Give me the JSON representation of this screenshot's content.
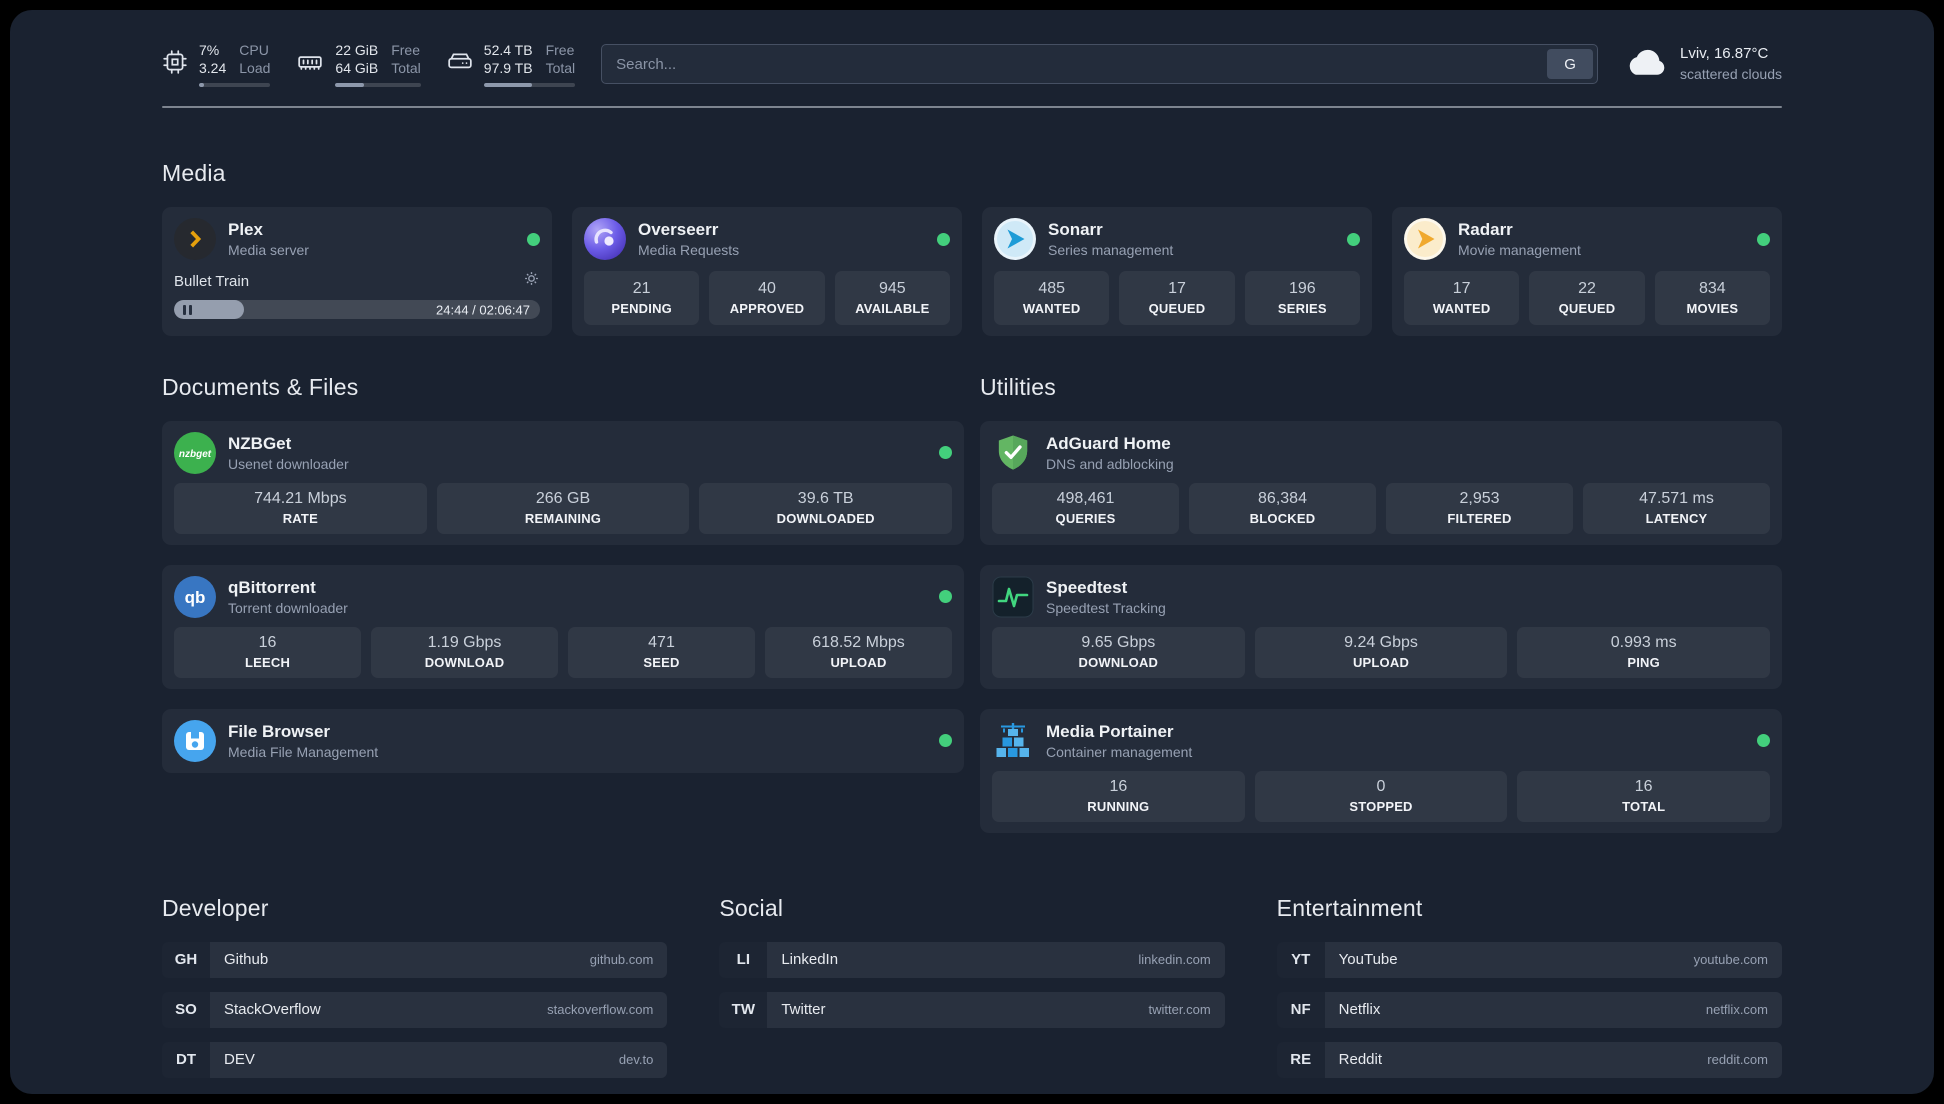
{
  "topbar": {
    "resources": [
      {
        "icon": "cpu-icon",
        "values": [
          "7%",
          "3.24"
        ],
        "labels": [
          "CPU",
          "Load"
        ],
        "progress": 7
      },
      {
        "icon": "memory-icon",
        "values": [
          "22 GiB",
          "64 GiB"
        ],
        "labels": [
          "Free",
          "Total"
        ],
        "progress": 34
      },
      {
        "icon": "disk-icon",
        "values": [
          "52.4 TB",
          "97.9 TB"
        ],
        "labels": [
          "Free",
          "Total"
        ],
        "progress": 53
      }
    ],
    "search": {
      "placeholder": "Search...",
      "button_label": "G"
    },
    "weather": {
      "location": "Lviv, 16.87°C",
      "condition": "scattered clouds"
    }
  },
  "sections": {
    "media": {
      "title": "Media",
      "plex": {
        "name": "Plex",
        "subtitle": "Media server",
        "player": {
          "title": "Bullet Train",
          "time": "24:44 / 02:06:47",
          "progress": 19
        }
      },
      "overseerr": {
        "name": "Overseerr",
        "subtitle": "Media Requests",
        "stats": [
          {
            "value": "21",
            "label": "PENDING"
          },
          {
            "value": "40",
            "label": "APPROVED"
          },
          {
            "value": "945",
            "label": "AVAILABLE"
          }
        ]
      },
      "sonarr": {
        "name": "Sonarr",
        "subtitle": "Series management",
        "stats": [
          {
            "value": "485",
            "label": "WANTED"
          },
          {
            "value": "17",
            "label": "QUEUED"
          },
          {
            "value": "196",
            "label": "SERIES"
          }
        ]
      },
      "radarr": {
        "name": "Radarr",
        "subtitle": "Movie management",
        "stats": [
          {
            "value": "17",
            "label": "WANTED"
          },
          {
            "value": "22",
            "label": "QUEUED"
          },
          {
            "value": "834",
            "label": "MOVIES"
          }
        ]
      }
    },
    "documents": {
      "title": "Documents & Files",
      "nzbget": {
        "name": "NZBGet",
        "subtitle": "Usenet downloader",
        "stats": [
          {
            "value": "744.21 Mbps",
            "label": "RATE"
          },
          {
            "value": "266 GB",
            "label": "REMAINING"
          },
          {
            "value": "39.6 TB",
            "label": "DOWNLOADED"
          }
        ]
      },
      "qbittorrent": {
        "name": "qBittorrent",
        "subtitle": "Torrent downloader",
        "stats": [
          {
            "value": "16",
            "label": "LEECH"
          },
          {
            "value": "1.19 Gbps",
            "label": "DOWNLOAD"
          },
          {
            "value": "471",
            "label": "SEED"
          },
          {
            "value": "618.52 Mbps",
            "label": "UPLOAD"
          }
        ]
      },
      "filebrowser": {
        "name": "File Browser",
        "subtitle": "Media File Management"
      }
    },
    "utilities": {
      "title": "Utilities",
      "adguard": {
        "name": "AdGuard Home",
        "subtitle": "DNS and adblocking",
        "stats": [
          {
            "value": "498,461",
            "label": "QUERIES"
          },
          {
            "value": "86,384",
            "label": "BLOCKED"
          },
          {
            "value": "2,953",
            "label": "FILTERED"
          },
          {
            "value": "47.571 ms",
            "label": "LATENCY"
          }
        ]
      },
      "speedtest": {
        "name": "Speedtest",
        "subtitle": "Speedtest Tracking",
        "stats": [
          {
            "value": "9.65 Gbps",
            "label": "DOWNLOAD"
          },
          {
            "value": "9.24 Gbps",
            "label": "UPLOAD"
          },
          {
            "value": "0.993 ms",
            "label": "PING"
          }
        ]
      },
      "portainer": {
        "name": "Media Portainer",
        "subtitle": "Container management",
        "stats": [
          {
            "value": "16",
            "label": "RUNNING"
          },
          {
            "value": "0",
            "label": "STOPPED"
          },
          {
            "value": "16",
            "label": "TOTAL"
          }
        ]
      }
    },
    "bookmarks": [
      {
        "title": "Developer",
        "items": [
          {
            "abbr": "GH",
            "name": "Github",
            "domain": "github.com"
          },
          {
            "abbr": "SO",
            "name": "StackOverflow",
            "domain": "stackoverflow.com"
          },
          {
            "abbr": "DT",
            "name": "DEV",
            "domain": "dev.to"
          }
        ]
      },
      {
        "title": "Social",
        "items": [
          {
            "abbr": "LI",
            "name": "LinkedIn",
            "domain": "linkedin.com"
          },
          {
            "abbr": "TW",
            "name": "Twitter",
            "domain": "twitter.com"
          }
        ]
      },
      {
        "title": "Entertainment",
        "items": [
          {
            "abbr": "YT",
            "name": "YouTube",
            "domain": "youtube.com"
          },
          {
            "abbr": "NF",
            "name": "Netflix",
            "domain": "netflix.com"
          },
          {
            "abbr": "RE",
            "name": "Reddit",
            "domain": "reddit.com"
          }
        ]
      }
    ]
  }
}
